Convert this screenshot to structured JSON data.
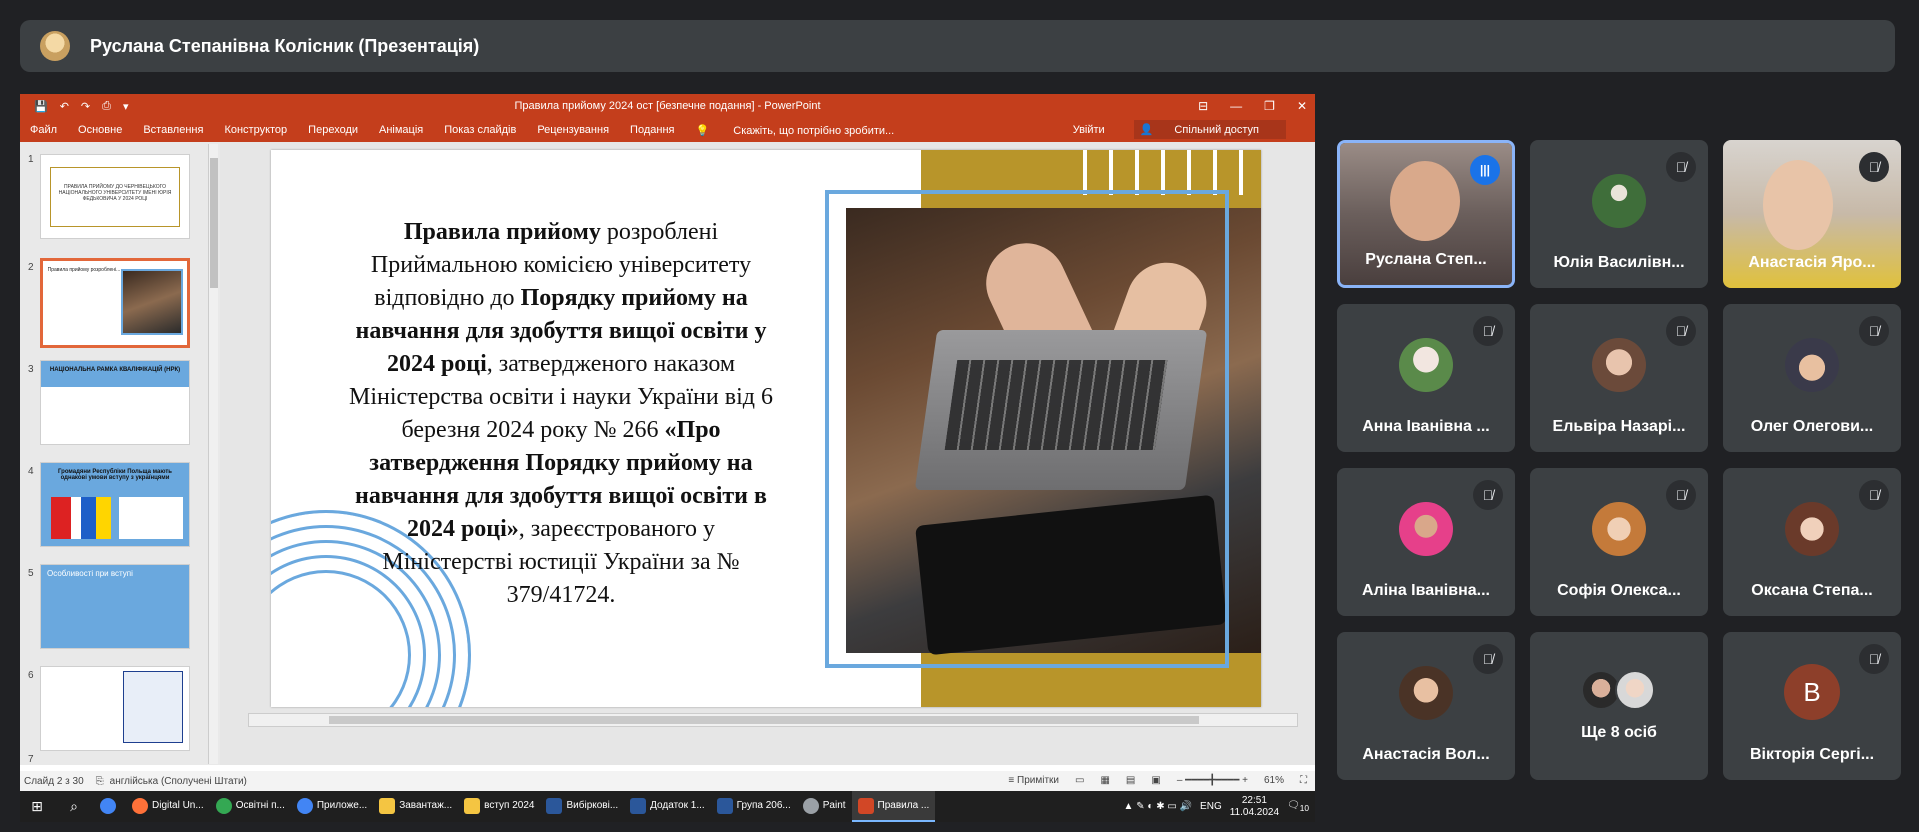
{
  "header": {
    "presenter_title": "Руслана Степанівна Колісник (Презентація)"
  },
  "powerpoint": {
    "window_title": "Правила прийому 2024 ост [безпечне подання] - PowerPoint",
    "quick_access": [
      "💾",
      "↶",
      "↷",
      "⎙",
      "▾"
    ],
    "window_controls": [
      "⊟",
      "—",
      "❐",
      "✕"
    ],
    "ribbon_tabs": [
      "Файл",
      "Основне",
      "Вставлення",
      "Конструктор",
      "Переходи",
      "Анімація",
      "Показ слайдів",
      "Рецензування",
      "Подання"
    ],
    "tell_me": "Скажіть, що потрібно зробити...",
    "signin": "Увійти",
    "share": "Спільний доступ",
    "thumbnails": [
      {
        "num": "1",
        "text": "ПРАВИЛА ПРИЙОМУ ДО ЧЕРНІВЕЦЬКОГО НАЦІОНАЛЬНОГО УНІВЕРСИТЕТУ ІМЕНІ ЮРІЯ ФЕДЬКОВИЧА У 2024 РОЦІ"
      },
      {
        "num": "2",
        "text": "Правила прийому розроблені..."
      },
      {
        "num": "3",
        "text": "НАЦІОНАЛЬНА РАМКА КВАЛІФІКАЦІЙ (НРК)"
      },
      {
        "num": "4",
        "text": "Громадяни Республіки Польща мають однакові умови вступу з українцями"
      },
      {
        "num": "5",
        "text": "Особливості при вступі"
      },
      {
        "num": "6",
        "text": ""
      },
      {
        "num": "7",
        "text": ""
      }
    ],
    "slide_text": {
      "p1": "Правила прийому",
      "p2": " розроблені Приймальною комісією університету відповідно до ",
      "p3": "Порядку прийому на навчання для здобуття вищої освіти у 2024 році",
      "p4": ", затвердженого наказом Міністерства освіти і науки України від 6 березня 2024 року № 266 ",
      "p5": "«Про затвердження Порядку прийому на навчання для здобуття вищої освіти в 2024 році»",
      "p6": ", зареєстрованого у Міністерстві юстиції України за № 379/41724."
    },
    "status_left": "Слайд 2 з 30",
    "status_lang": "англійська (Сполучені Штати)",
    "status_notes": "Примітки",
    "zoom": "61%"
  },
  "taskbar": {
    "apps": [
      {
        "label": "",
        "color": "#4285f4"
      },
      {
        "label": "Digital Un...",
        "color": "#ff7139"
      },
      {
        "label": "Освітні п...",
        "color": "#34a853"
      },
      {
        "label": "Приложе...",
        "color": "#4285f4"
      },
      {
        "label": "Завантаж...",
        "color": "#f4c542"
      },
      {
        "label": "вступ 2024",
        "color": "#f4c542"
      },
      {
        "label": "Вибіркові...",
        "color": "#2b579a"
      },
      {
        "label": "Додаток 1...",
        "color": "#2b579a"
      },
      {
        "label": "Група 206...",
        "color": "#2b579a"
      },
      {
        "label": "Paint",
        "color": "#9aa0a6"
      },
      {
        "label": "Правила ...",
        "color": "#d24726"
      }
    ],
    "lang": "ENG",
    "time": "22:51",
    "date": "11.04.2024",
    "notif": "10"
  },
  "participants": [
    {
      "name": "Руслана Степ...",
      "active": true
    },
    {
      "name": "Юлія Василівн...",
      "active": false
    },
    {
      "name": "Анастасія Яро...",
      "active": false
    },
    {
      "name": "Анна Іванівна ...",
      "active": false
    },
    {
      "name": "Ельвіра Назарі...",
      "active": false
    },
    {
      "name": "Олег Олегови...",
      "active": false
    },
    {
      "name": "Аліна Іванівна...",
      "active": false
    },
    {
      "name": "Софія Олекса...",
      "active": false
    },
    {
      "name": "Оксана Степа...",
      "active": false
    },
    {
      "name": "Анастасія Вол...",
      "active": false
    },
    {
      "name": "Ще 8 осіб",
      "active": false
    },
    {
      "name": "Вікторія Сергі...",
      "active": false,
      "letter": "В"
    }
  ],
  "colors": {
    "ppt": "#c43e1c",
    "meet_tile": "#3c4043",
    "active_border": "#8ab4f8"
  }
}
